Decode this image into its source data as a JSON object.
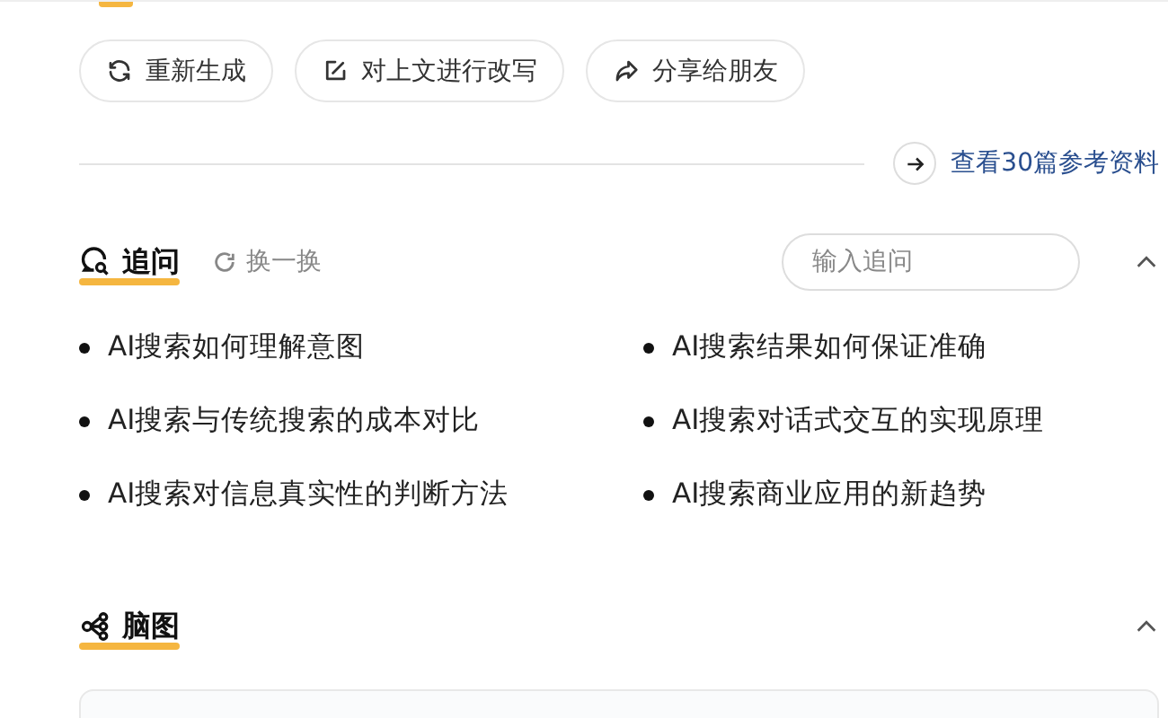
{
  "actions": [
    {
      "kind": "refresh",
      "label": "重新生成"
    },
    {
      "kind": "edit",
      "label": "对上文进行改写"
    },
    {
      "kind": "share",
      "label": "分享给朋友"
    }
  ],
  "references": {
    "label": "查看30篇参考资料"
  },
  "follow_up": {
    "title": "追问",
    "shuffle": "换一换",
    "input": {
      "placeholder": "输入追问"
    },
    "expanded": true,
    "questions": [
      "AI搜索如何理解意图",
      "AI搜索结果如何保证准确",
      "AI搜索与传统搜索的成本对比",
      "AI搜索对话式交互的实现原理",
      "AI搜索对信息真实性的判断方法",
      "AI搜索商业应用的新趋势"
    ]
  },
  "mind_map": {
    "title": "脑图",
    "expanded": true
  }
}
